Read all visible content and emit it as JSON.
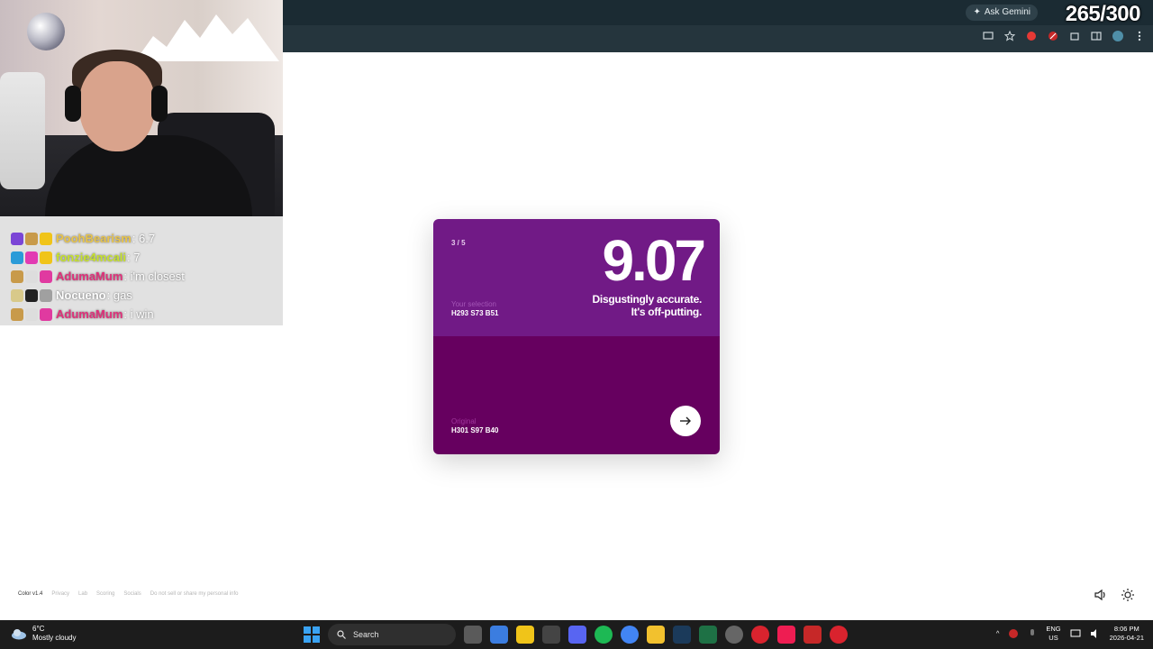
{
  "stream": {
    "goal_counter": "265/300",
    "chat": [
      {
        "user": "PoohBearism",
        "message": ": 6.7",
        "color": "#e8c44a"
      },
      {
        "user": "fonzie4mcali",
        "message": ": 7",
        "color": "#c6e22c"
      },
      {
        "user": "AdumaMum",
        "message": ": i'm closest",
        "color": "#e0307a"
      },
      {
        "user": "Nocueno",
        "message": ": gas",
        "color": "#ffffff"
      },
      {
        "user": "AdumaMum",
        "message": ": i win",
        "color": "#e0307a"
      }
    ]
  },
  "browser": {
    "ask_gemini_label": "Ask Gemini"
  },
  "result_card": {
    "round": "3 / 5",
    "score": "9.07",
    "comment_line1": "Disgustingly accurate.",
    "comment_line2": "It's off-putting.",
    "selection_label": "Your selection",
    "selection_value": "H293 S73 B51",
    "original_label": "Original",
    "original_value": "H301 S97 B40",
    "selection_color": "#711a86",
    "original_color": "#66005f"
  },
  "footer": {
    "version": "Color v1.4",
    "links": [
      "Privacy",
      "Lab",
      "Scoring",
      "Socials",
      "Do not sell or share my personal info"
    ]
  },
  "taskbar": {
    "temperature": "6°C",
    "weather": "Mostly cloudy",
    "search_label": "Search",
    "language": "ENG",
    "region": "US",
    "time": "8:06 PM",
    "date": "2026-04-21"
  }
}
